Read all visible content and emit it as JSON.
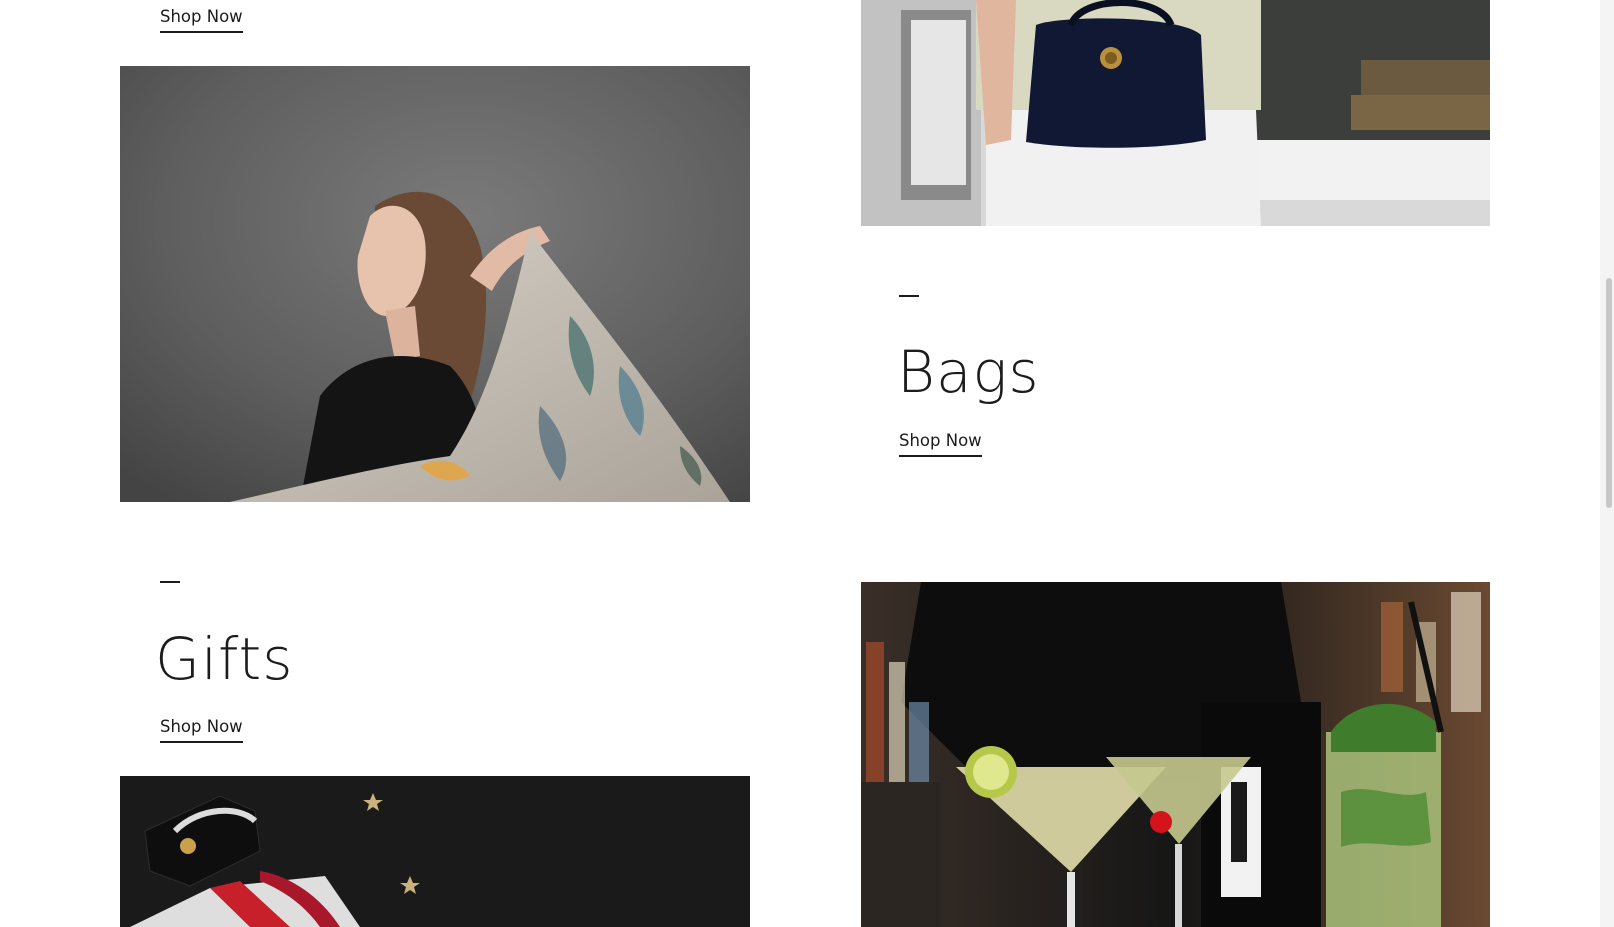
{
  "sections": {
    "top_left": {
      "link": "Shop Now"
    },
    "scarves": {
      "image_alt": "Woman holding a floral printed scarf"
    },
    "bags": {
      "title": "Bags",
      "link": "Shop Now",
      "image_alt": "Woman holding a navy croc-embossed handbag"
    },
    "gifts": {
      "title": "Gifts",
      "link": "Shop Now",
      "image_alt": "Gift wrapping with ribbon on black background"
    },
    "bar": {
      "image_alt": "Cocktails on a bar counter"
    }
  },
  "colors": {
    "text": "#1c1c1c",
    "background": "#ffffff",
    "scarf_bg": "#5f5f5f",
    "gift_bg": "#1a1a1a"
  }
}
